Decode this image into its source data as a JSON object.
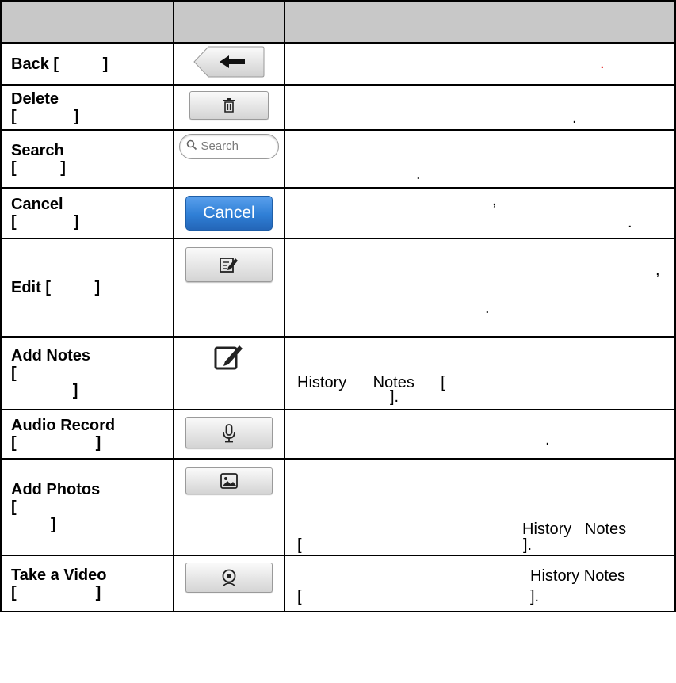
{
  "rows": [
    {
      "name": "Back [          ]",
      "desc": [
        {
          "text": ".",
          "color": "#e00000"
        }
      ]
    },
    {
      "name": "Delete\n[             ]",
      "desc": [
        {
          "text": "."
        }
      ]
    },
    {
      "name": "Search\n[          ]",
      "button_text": "Search",
      "desc": [
        {
          "text": "."
        }
      ]
    },
    {
      "name": "Cancel\n[             ]",
      "button_text": "Cancel",
      "desc": [
        {
          "text": ","
        },
        {
          "text": "."
        }
      ]
    },
    {
      "name": "Edit [          ]",
      "desc": [
        {
          "text": ","
        },
        {
          "text": "."
        }
      ]
    },
    {
      "name": "Add Notes\n[\n              ]",
      "desc": [
        {
          "text": "History      Notes      ["
        },
        {
          "text": "]."
        }
      ]
    },
    {
      "name": "Audio Record\n[                  ]",
      "desc": [
        {
          "text": "."
        }
      ]
    },
    {
      "name": "Add Photos\n[\n         ]",
      "desc": [
        {
          "text": "History   Notes"
        },
        {
          "text": "["
        },
        {
          "text": "]."
        }
      ]
    },
    {
      "name": "Take a Video\n[                  ]",
      "desc": [
        {
          "text": "History Notes"
        },
        {
          "text": "["
        },
        {
          "text": "]."
        }
      ]
    }
  ],
  "icons": [
    "back-arrow-icon",
    "trash-icon",
    "magnifier-icon",
    "edit-pencil-icon",
    "note-edit-icon",
    "microphone-icon",
    "photo-icon",
    "video-camera-icon"
  ],
  "colors": {
    "header_bg": "#c8c8c8",
    "cancel_blue": "#2f7fd6",
    "accent_red": "#e00000"
  }
}
